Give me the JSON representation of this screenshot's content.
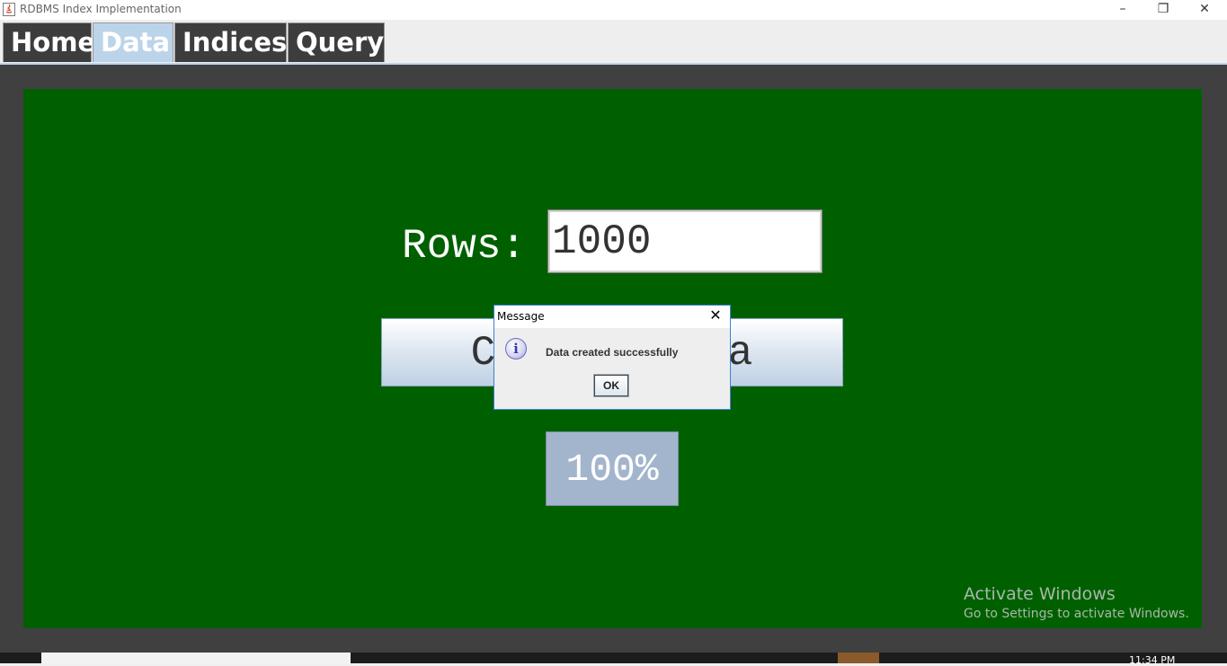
{
  "window": {
    "title": "RDBMS Index Implementation",
    "minimize_glyph": "–",
    "restore_glyph": "❐",
    "close_glyph": "✕"
  },
  "tabs": [
    {
      "label": "Home",
      "active": false
    },
    {
      "label": "Data",
      "active": true
    },
    {
      "label": "Indices",
      "active": false
    },
    {
      "label": "Query",
      "active": false
    }
  ],
  "form": {
    "rows_label": "Rows:",
    "rows_value": "1000",
    "create_button_label": "Create Data",
    "progress_text": "100%",
    "progress_value": 1.0
  },
  "dialog": {
    "title": "Message",
    "message": "Data created successfully",
    "ok_label": "OK",
    "close_glyph": "✕",
    "icon": "info-icon",
    "icon_glyph": "i"
  },
  "watermark": {
    "line1": "Activate Windows",
    "line2": "Go to Settings to activate Windows."
  },
  "taskbar": {
    "clock": "11:34 PM"
  },
  "colors": {
    "panel_bg": "#006000",
    "outer_bg": "#404040",
    "tab_bg": "#3d3d3d",
    "tab_active_bg": "#bcd4ea",
    "dialog_border": "#3c82d8",
    "progress_bg": "#a3b5cc"
  }
}
